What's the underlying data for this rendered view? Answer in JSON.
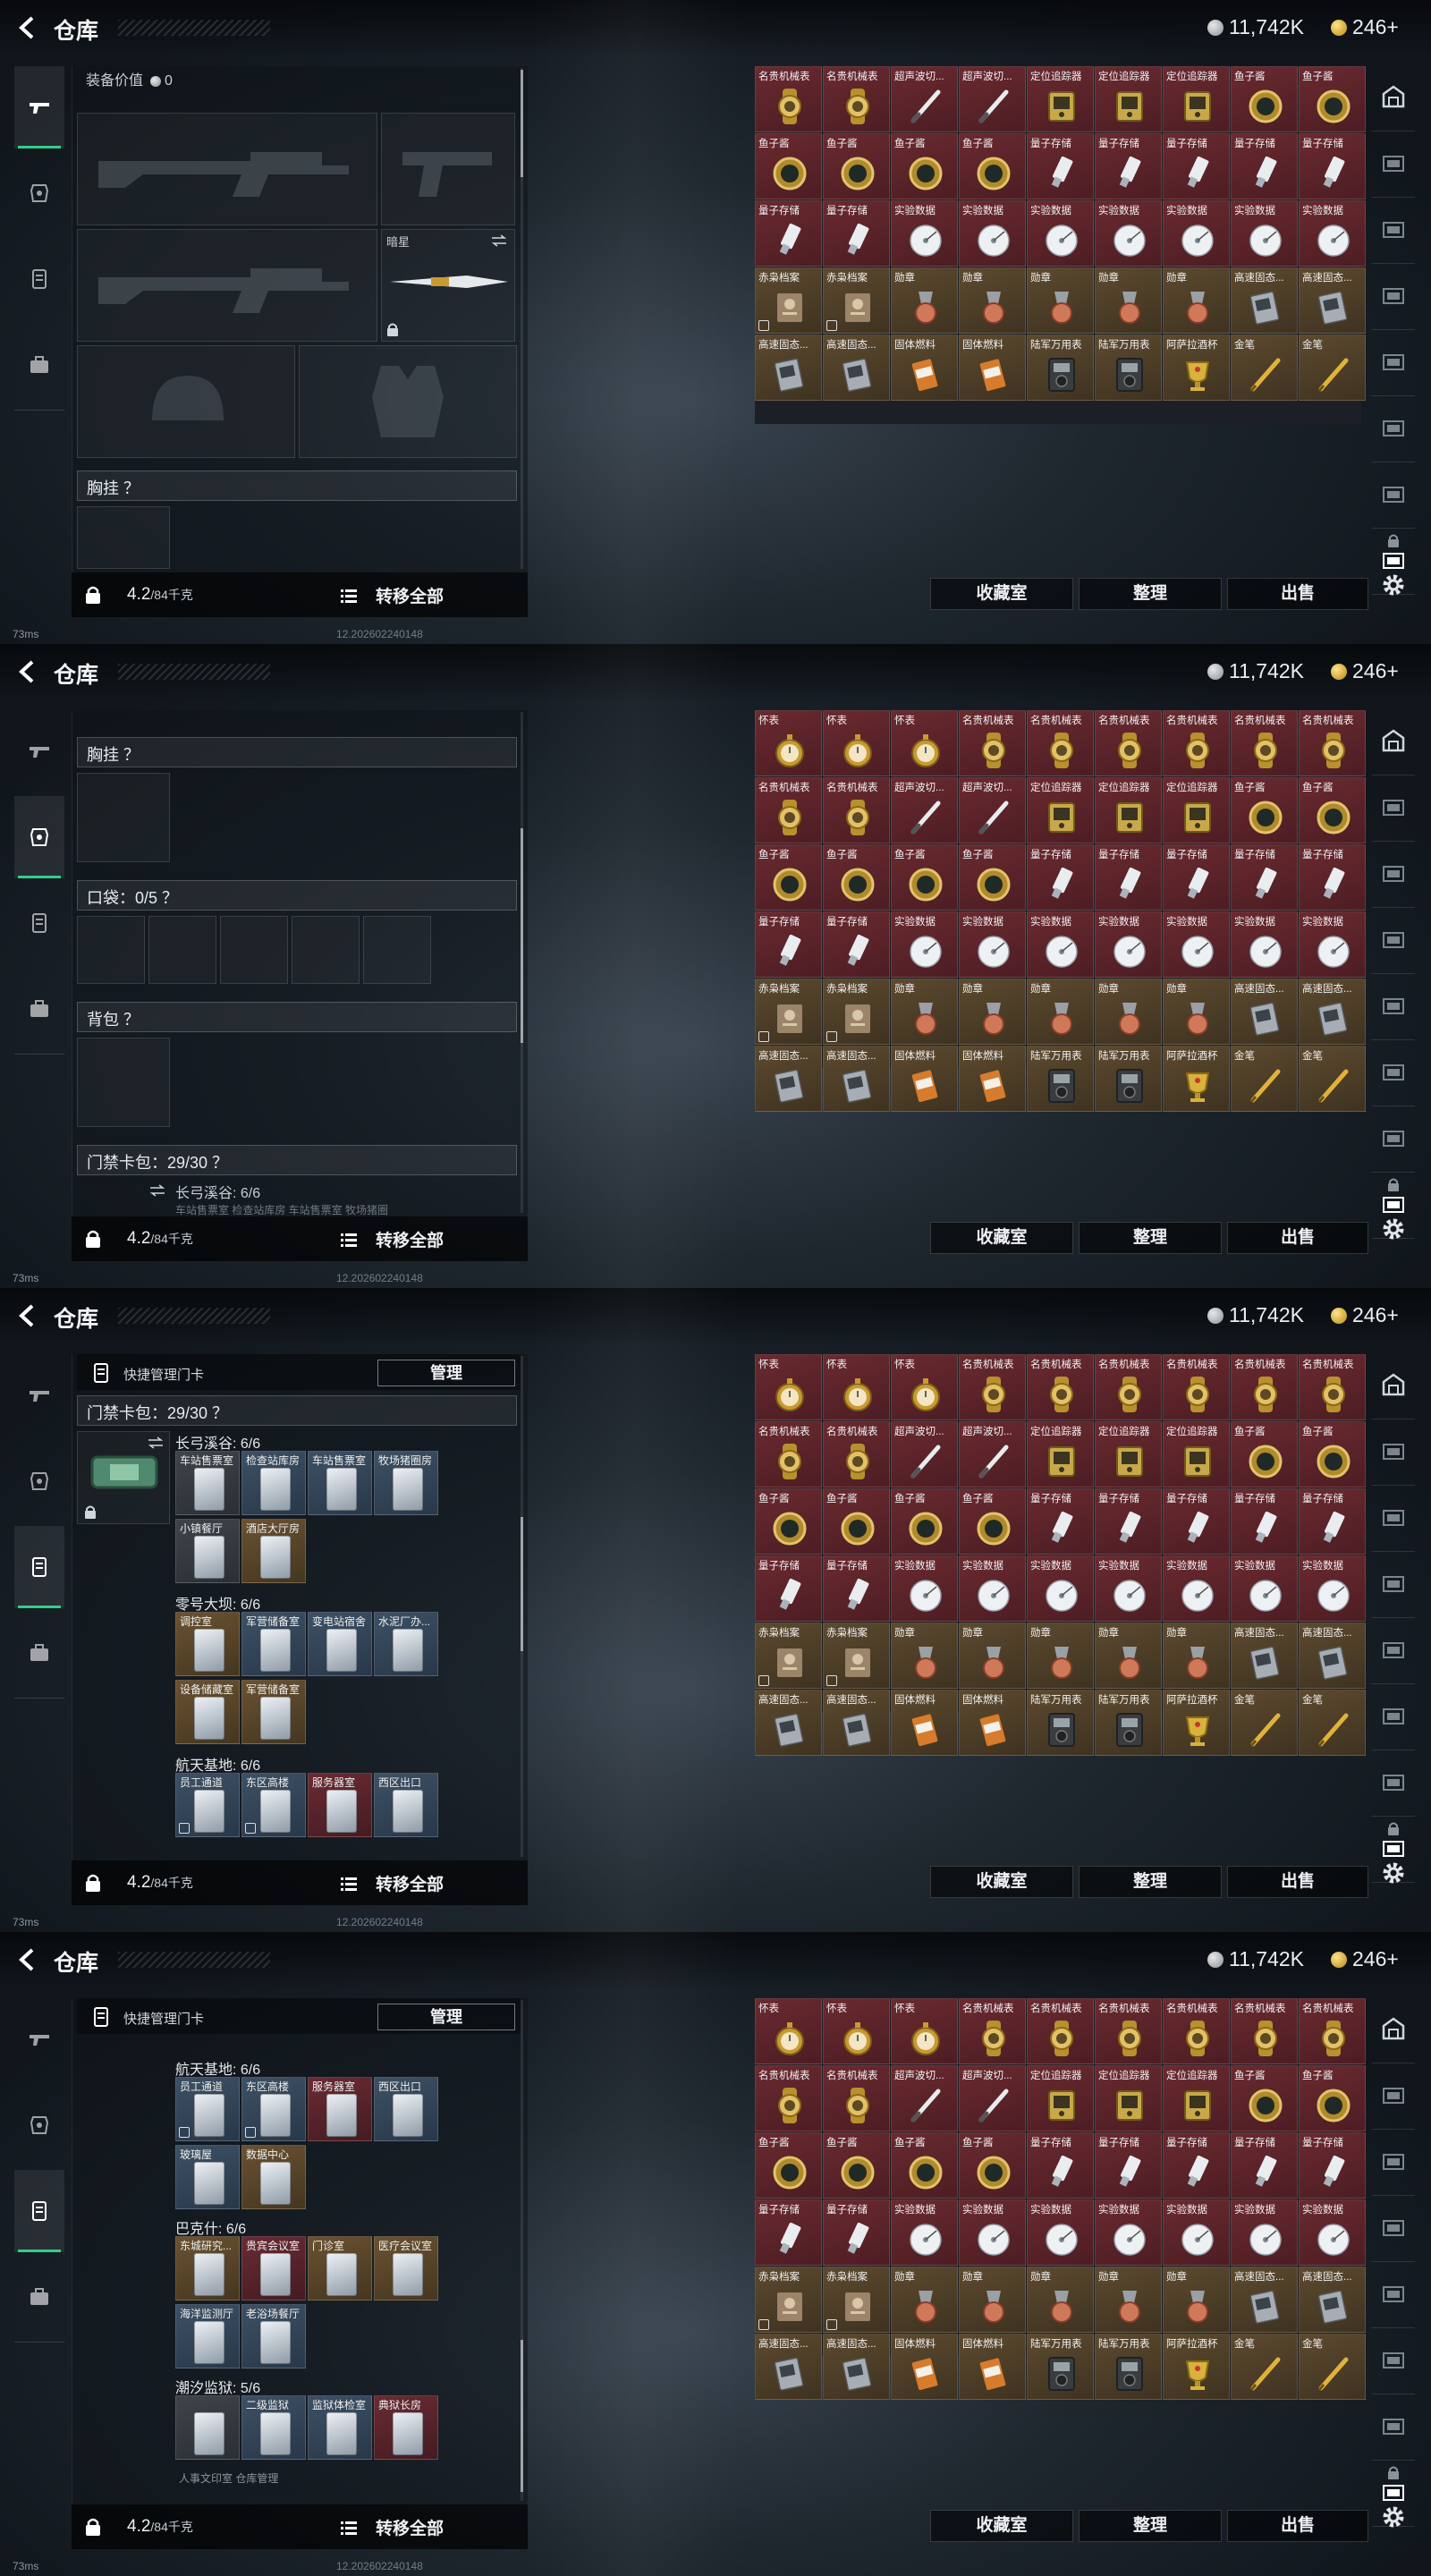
{
  "header": {
    "title": "仓库",
    "silver": "11,742K",
    "gold": "246+"
  },
  "status": {
    "ping": "73ms",
    "build": "12.202602240148"
  },
  "bottom": {
    "weight_value": "4.2",
    "weight_capacity": "/84千克",
    "transfer_all": "转移全部"
  },
  "buttons": {
    "collection": "收藏室",
    "sort": "整理",
    "sell": "出售"
  },
  "screen1": {
    "equip_value_label": "装备价值",
    "equip_value": "0",
    "slot_name": "暗星",
    "chest_rig": "胸挂 ？",
    "grid_items": [
      {
        "name": "名贵机械表",
        "icon": "watch-gold",
        "r": "red"
      },
      {
        "name": "名贵机械表",
        "icon": "watch-gold",
        "r": "red"
      },
      {
        "name": "超声波切...",
        "icon": "pen-tool",
        "r": "red"
      },
      {
        "name": "超声波切...",
        "icon": "pen-tool",
        "r": "red"
      },
      {
        "name": "定位追踪器",
        "icon": "tracker",
        "r": "red"
      },
      {
        "name": "定位追踪器",
        "icon": "tracker",
        "r": "red"
      },
      {
        "name": "定位追踪器",
        "icon": "tracker",
        "r": "red"
      },
      {
        "name": "鱼子酱",
        "icon": "caviar",
        "r": "red"
      },
      {
        "name": "鱼子酱",
        "icon": "caviar",
        "r": "red"
      },
      {
        "name": "鱼子酱",
        "icon": "caviar",
        "r": "red"
      },
      {
        "name": "鱼子酱",
        "icon": "caviar",
        "r": "red"
      },
      {
        "name": "鱼子酱",
        "icon": "caviar",
        "r": "red"
      },
      {
        "name": "鱼子酱",
        "icon": "caviar",
        "r": "red"
      },
      {
        "name": "量子存储",
        "icon": "usb",
        "r": "red"
      },
      {
        "name": "量子存储",
        "icon": "usb",
        "r": "red"
      },
      {
        "name": "量子存储",
        "icon": "usb",
        "r": "red"
      },
      {
        "name": "量子存储",
        "icon": "usb",
        "r": "red"
      },
      {
        "name": "量子存储",
        "icon": "usb",
        "r": "red"
      },
      {
        "name": "量子存储",
        "icon": "usb",
        "r": "red"
      },
      {
        "name": "量子存储",
        "icon": "usb",
        "r": "red"
      },
      {
        "name": "实验数据",
        "icon": "disc",
        "r": "red"
      },
      {
        "name": "实验数据",
        "icon": "disc",
        "r": "red"
      },
      {
        "name": "实验数据",
        "icon": "disc",
        "r": "red"
      },
      {
        "name": "实验数据",
        "icon": "disc",
        "r": "red"
      },
      {
        "name": "实验数据",
        "icon": "disc",
        "r": "red"
      },
      {
        "name": "实验数据",
        "icon": "disc",
        "r": "red"
      },
      {
        "name": "实验数据",
        "icon": "disc",
        "r": "red"
      },
      {
        "name": "赤枭档案",
        "icon": "file",
        "r": "gold",
        "tag": true
      },
      {
        "name": "赤枭档案",
        "icon": "file",
        "r": "gold",
        "tag": true
      },
      {
        "name": "勋章",
        "icon": "medal",
        "r": "gold"
      },
      {
        "name": "勋章",
        "icon": "medal",
        "r": "gold"
      },
      {
        "name": "勋章",
        "icon": "medal",
        "r": "gold"
      },
      {
        "name": "勋章",
        "icon": "medal",
        "r": "gold"
      },
      {
        "name": "勋章",
        "icon": "medal",
        "r": "gold"
      },
      {
        "name": "高速固态...",
        "icon": "ssd",
        "r": "gold"
      },
      {
        "name": "高速固态...",
        "icon": "ssd",
        "r": "gold"
      },
      {
        "name": "高速固态...",
        "icon": "ssd",
        "r": "gold"
      },
      {
        "name": "高速固态...",
        "icon": "ssd",
        "r": "gold"
      },
      {
        "name": "固体燃料",
        "icon": "fuel",
        "r": "gold"
      },
      {
        "name": "固体燃料",
        "icon": "fuel",
        "r": "gold"
      },
      {
        "name": "陆军万用表",
        "icon": "meter",
        "r": "gold"
      },
      {
        "name": "陆军万用表",
        "icon": "meter",
        "r": "gold"
      },
      {
        "name": "阿萨拉酒杯",
        "icon": "cup",
        "r": "gold"
      },
      {
        "name": "金笔",
        "icon": "goldpen",
        "r": "gold"
      },
      {
        "name": "金笔",
        "icon": "goldpen",
        "r": "gold"
      }
    ]
  },
  "screen2": {
    "chest_rig": "胸挂 ？",
    "pockets": "口袋：0/5 ？",
    "backpack": "背包 ？",
    "keycard_bag": "门禁卡包：29/30 ？",
    "sub_group": "长弓溪谷: 6/6",
    "sub_cards": "车站售票室 检查站库房 车站售票室 牧场猪圈"
  },
  "full_grid": [
    {
      "name": "怀表",
      "icon": "pocketwatch",
      "r": "red"
    },
    {
      "name": "怀表",
      "icon": "pocketwatch",
      "r": "red"
    },
    {
      "name": "怀表",
      "icon": "pocketwatch",
      "r": "red"
    },
    {
      "name": "名贵机械表",
      "icon": "watch-gold",
      "r": "red"
    },
    {
      "name": "名贵机械表",
      "icon": "watch-gold",
      "r": "red"
    },
    {
      "name": "名贵机械表",
      "icon": "watch-gold",
      "r": "red"
    },
    {
      "name": "名贵机械表",
      "icon": "watch-gold",
      "r": "red"
    },
    {
      "name": "名贵机械表",
      "icon": "watch-gold",
      "r": "red"
    },
    {
      "name": "名贵机械表",
      "icon": "watch-gold",
      "r": "red"
    },
    {
      "name": "名贵机械表",
      "icon": "watch-gold",
      "r": "red"
    },
    {
      "name": "名贵机械表",
      "icon": "watch-gold",
      "r": "red"
    },
    {
      "name": "超声波切...",
      "icon": "pen-tool",
      "r": "red"
    },
    {
      "name": "超声波切...",
      "icon": "pen-tool",
      "r": "red"
    },
    {
      "name": "定位追踪器",
      "icon": "tracker",
      "r": "red"
    },
    {
      "name": "定位追踪器",
      "icon": "tracker",
      "r": "red"
    },
    {
      "name": "定位追踪器",
      "icon": "tracker",
      "r": "red"
    },
    {
      "name": "鱼子酱",
      "icon": "caviar",
      "r": "red"
    },
    {
      "name": "鱼子酱",
      "icon": "caviar",
      "r": "red"
    },
    {
      "name": "鱼子酱",
      "icon": "caviar",
      "r": "red"
    },
    {
      "name": "鱼子酱",
      "icon": "caviar",
      "r": "red"
    },
    {
      "name": "鱼子酱",
      "icon": "caviar",
      "r": "red"
    },
    {
      "name": "鱼子酱",
      "icon": "caviar",
      "r": "red"
    },
    {
      "name": "量子存储",
      "icon": "usb",
      "r": "red"
    },
    {
      "name": "量子存储",
      "icon": "usb",
      "r": "red"
    },
    {
      "name": "量子存储",
      "icon": "usb",
      "r": "red"
    },
    {
      "name": "量子存储",
      "icon": "usb",
      "r": "red"
    },
    {
      "name": "量子存储",
      "icon": "usb",
      "r": "red"
    },
    {
      "name": "量子存储",
      "icon": "usb",
      "r": "red"
    },
    {
      "name": "量子存储",
      "icon": "usb",
      "r": "red"
    },
    {
      "name": "实验数据",
      "icon": "disc",
      "r": "red"
    },
    {
      "name": "实验数据",
      "icon": "disc",
      "r": "red"
    },
    {
      "name": "实验数据",
      "icon": "disc",
      "r": "red"
    },
    {
      "name": "实验数据",
      "icon": "disc",
      "r": "red"
    },
    {
      "name": "实验数据",
      "icon": "disc",
      "r": "red"
    },
    {
      "name": "实验数据",
      "icon": "disc",
      "r": "red"
    },
    {
      "name": "实验数据",
      "icon": "disc",
      "r": "red"
    },
    {
      "name": "赤枭档案",
      "icon": "file",
      "r": "gold",
      "tag": true
    },
    {
      "name": "赤枭档案",
      "icon": "file",
      "r": "gold",
      "tag": true
    },
    {
      "name": "勋章",
      "icon": "medal",
      "r": "gold"
    },
    {
      "name": "勋章",
      "icon": "medal",
      "r": "gold"
    },
    {
      "name": "勋章",
      "icon": "medal",
      "r": "gold"
    },
    {
      "name": "勋章",
      "icon": "medal",
      "r": "gold"
    },
    {
      "name": "勋章",
      "icon": "medal",
      "r": "gold"
    },
    {
      "name": "高速固态...",
      "icon": "ssd",
      "r": "gold"
    },
    {
      "name": "高速固态...",
      "icon": "ssd",
      "r": "gold"
    },
    {
      "name": "高速固态...",
      "icon": "ssd",
      "r": "gold"
    },
    {
      "name": "高速固态...",
      "icon": "ssd",
      "r": "gold"
    },
    {
      "name": "固体燃料",
      "icon": "fuel",
      "r": "gold"
    },
    {
      "name": "固体燃料",
      "icon": "fuel",
      "r": "gold"
    },
    {
      "name": "陆军万用表",
      "icon": "meter",
      "r": "gold"
    },
    {
      "name": "陆军万用表",
      "icon": "meter",
      "r": "gold"
    },
    {
      "name": "阿萨拉酒杯",
      "icon": "cup",
      "r": "gold"
    },
    {
      "name": "金笔",
      "icon": "goldpen",
      "r": "gold"
    },
    {
      "name": "金笔",
      "icon": "goldpen",
      "r": "gold"
    }
  ],
  "screen3": {
    "quick_manage": "快捷管理门卡",
    "manage": "管理",
    "keycard_bag": "门禁卡包：29/30 ？",
    "groups": [
      {
        "title": "长弓溪谷: 6/6",
        "cards": [
          {
            "name": "车站售票室",
            "c": "gray"
          },
          {
            "name": "检查站库房",
            "c": "blue"
          },
          {
            "name": "车站售票室",
            "c": "blue"
          },
          {
            "name": "牧场猪圈房",
            "c": "blue"
          },
          {
            "name": "小镇餐厅",
            "c": "gray"
          },
          {
            "name": "酒店大厅房",
            "c": "gold"
          }
        ]
      },
      {
        "title": "零号大坝: 6/6",
        "cards": [
          {
            "name": "调控室",
            "c": "gold"
          },
          {
            "name": "军营储备室",
            "c": "blue"
          },
          {
            "name": "变电站宿舍",
            "c": "blue"
          },
          {
            "name": "水泥厂办...",
            "c": "blue"
          },
          {
            "name": "设备储藏室",
            "c": "gold"
          },
          {
            "name": "军营储备室",
            "c": "gold"
          }
        ]
      },
      {
        "title": "航天基地: 6/6",
        "cards": [
          {
            "name": "员工通道",
            "c": "blue",
            "tag": true
          },
          {
            "name": "东区高楼",
            "c": "blue",
            "tag": true
          },
          {
            "name": "服务器室",
            "c": "red"
          },
          {
            "name": "西区出口",
            "c": "blue"
          }
        ]
      }
    ]
  },
  "screen4": {
    "groups": [
      {
        "title": "航天基地: 6/6",
        "cards": [
          {
            "name": "员工通道",
            "c": "blue",
            "tag": true
          },
          {
            "name": "东区高楼",
            "c": "blue",
            "tag": true
          },
          {
            "name": "服务器室",
            "c": "red"
          },
          {
            "name": "西区出口",
            "c": "blue"
          },
          {
            "name": "玻璃屋",
            "c": "blue"
          },
          {
            "name": "数据中心",
            "c": "gold"
          }
        ]
      },
      {
        "title": "巴克什: 6/6",
        "cards": [
          {
            "name": "东城研究...",
            "c": "gold"
          },
          {
            "name": "贵宾会议室",
            "c": "red"
          },
          {
            "name": "门诊室",
            "c": "gold"
          },
          {
            "name": "医疗会议室",
            "c": "gold"
          },
          {
            "name": "海洋监测厅",
            "c": "blue"
          },
          {
            "name": "老浴场餐厅",
            "c": "blue"
          }
        ]
      },
      {
        "title": "潮汐监狱: 5/6",
        "cards": [
          {
            "name": "",
            "c": "gray"
          },
          {
            "name": "二级监狱",
            "c": "blue"
          },
          {
            "name": "监狱体检室",
            "c": "blue"
          },
          {
            "name": "典狱长房",
            "c": "red"
          }
        ]
      }
    ],
    "row_labels": "人事文印室 仓库管理"
  }
}
